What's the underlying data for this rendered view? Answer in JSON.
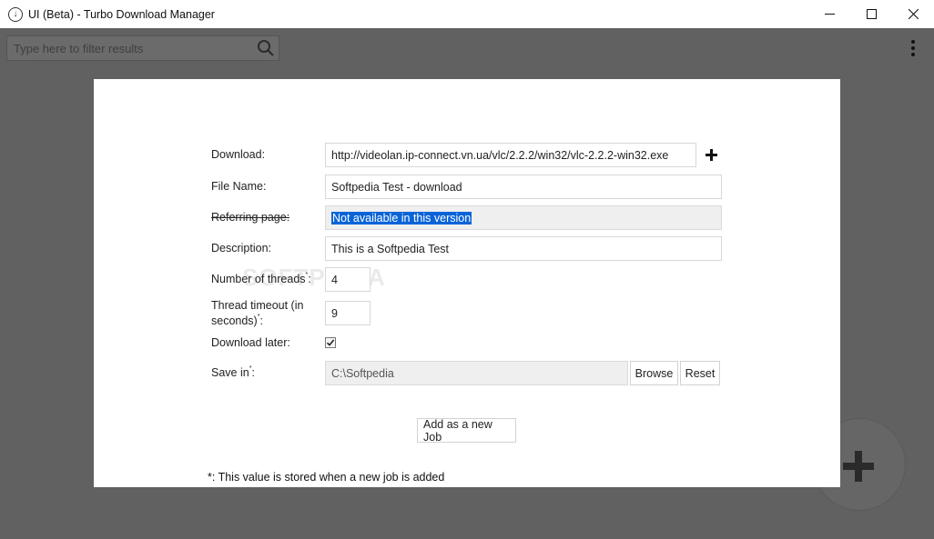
{
  "window": {
    "title": "UI (Beta) - Turbo Download Manager",
    "app_icon": "download-arrow-icon",
    "controls": {
      "minimize": "—",
      "maximize": "☐",
      "close": "✕"
    }
  },
  "toolbar": {
    "filter_placeholder": "Type here to filter results",
    "filter_value": "",
    "search_icon": "search-icon",
    "menu_icon": "more-vertical-icon"
  },
  "fab": {
    "icon": "plus-icon"
  },
  "form": {
    "download_label": "Download:",
    "download_value": "http://videolan.ip-connect.vn.ua/vlc/2.2.2/win32/vlc-2.2.2-win32.exe",
    "file_name_label": "File Name:",
    "file_name_value": "Softpedia Test - download",
    "referring_label": "Referring page:",
    "referring_value": "Not available in this version",
    "description_label": "Description:",
    "description_value": "This is a Softpedia Test",
    "threads_label": "Number of threads",
    "threads_value": "4",
    "timeout_label": "Thread timeout (in seconds)",
    "timeout_value": "9",
    "download_later_label": "Download later:",
    "download_later_checked": true,
    "save_in_label": "Save in",
    "save_in_value": "C:\\Softpedia",
    "browse_label": "Browse",
    "reset_label": "Reset",
    "asterisk": "*",
    "colon": ":",
    "add_job_label": "Add as a new Job",
    "footnote": "*: This value is stored when a new job is added",
    "watermark": "SOFTPEDIA"
  },
  "colors": {
    "overlay": "#616161",
    "selection": "#0a64d8"
  }
}
